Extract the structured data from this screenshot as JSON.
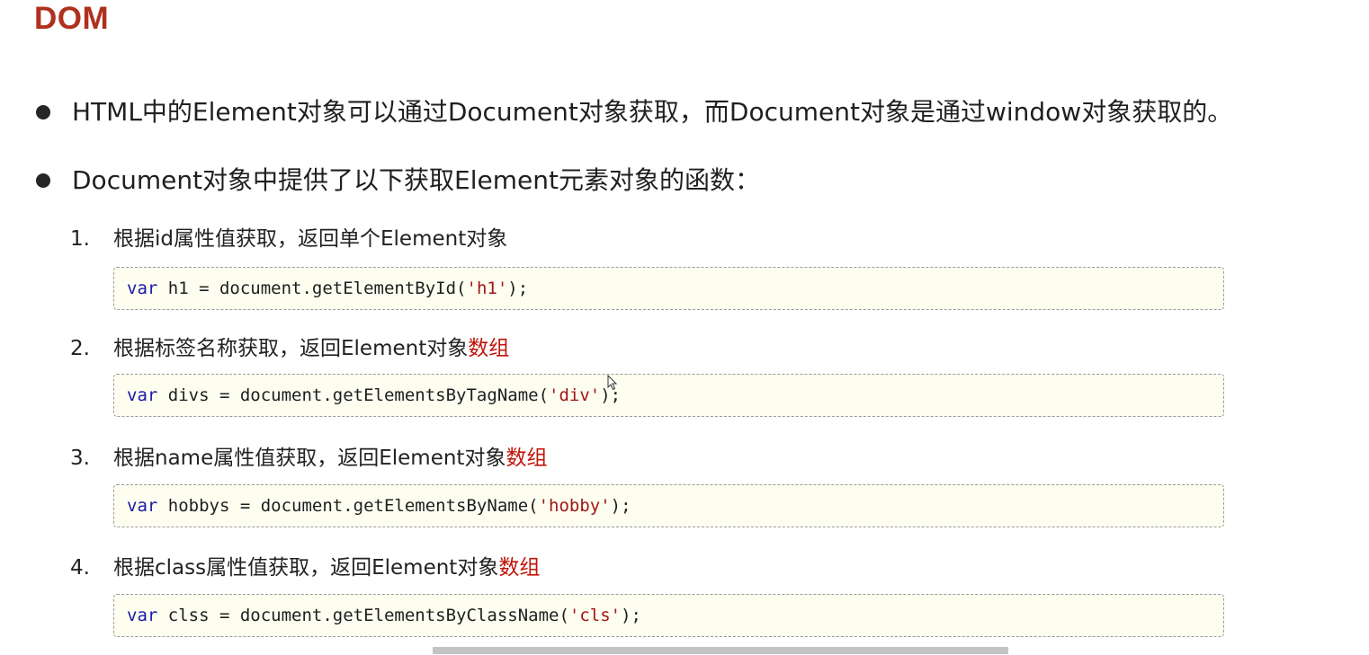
{
  "title": "DOM",
  "bullets": [
    "HTML中的Element对象可以通过Document对象获取，而Document对象是通过window对象获取的。",
    "Document对象中提供了以下获取Element元素对象的函数："
  ],
  "items": [
    {
      "number": "1.",
      "text": "根据id属性值获取，返回单个Element对象",
      "highlight": "",
      "code": {
        "keyword": "var",
        "before": " h1 = document.getElementById(",
        "string": "'h1'",
        "after": ");"
      }
    },
    {
      "number": "2.",
      "text": "根据标签名称获取，返回Element对象",
      "highlight": "数组",
      "code": {
        "keyword": "var",
        "before": " divs = document.getElementsByTagName(",
        "string": "'div'",
        "after": ");"
      }
    },
    {
      "number": "3.",
      "text": "根据name属性值获取，返回Element对象",
      "highlight": "数组",
      "code": {
        "keyword": "var",
        "before": " hobbys = document.getElementsByName(",
        "string": "'hobby'",
        "after": ");"
      }
    },
    {
      "number": "4.",
      "text": "根据class属性值获取，返回Element对象",
      "highlight": "数组",
      "code": {
        "keyword": "var",
        "before": " clss = document.getElementsByClassName(",
        "string": "'cls'",
        "after": ");"
      }
    }
  ],
  "colors": {
    "title": "#b0301e",
    "highlight": "#c0150a",
    "keyword": "#1a1aa6",
    "string": "#a31515",
    "code_background": "#fdfdf0"
  },
  "icons": {
    "cursor": "mouse-pointer-icon"
  }
}
